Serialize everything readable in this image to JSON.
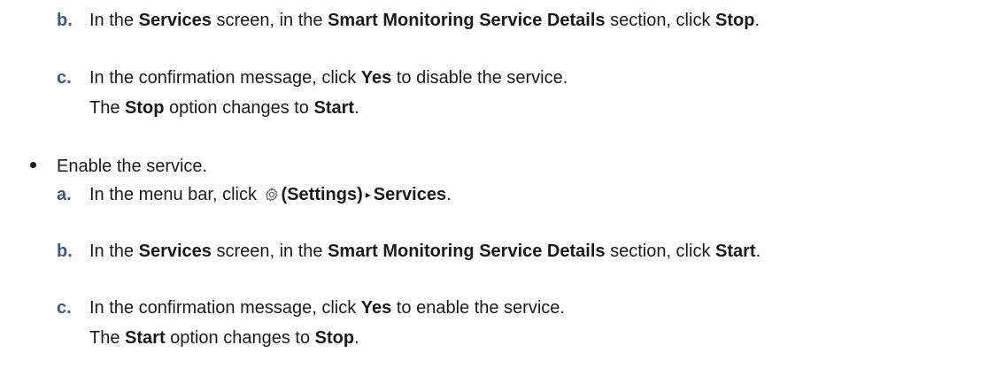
{
  "steps_disable": {
    "b": {
      "marker": "b.",
      "t1": "In the ",
      "b1": "Services",
      "t2": " screen, in the ",
      "b2": "Smart Monitoring Service Details",
      "t3": " section, click ",
      "b3": "Stop",
      "t4": "."
    },
    "c": {
      "marker": "c.",
      "t1": "In the confirmation message, click ",
      "b1": "Yes",
      "t2": " to disable the service.",
      "result": {
        "t1": "The ",
        "b1": "Stop",
        "t2": " option changes to ",
        "b2": "Start",
        "t3": "."
      }
    }
  },
  "enable": {
    "heading": "Enable the service.",
    "a": {
      "marker": "a.",
      "t1": "In the menu bar, click ",
      "icon": "gear-icon",
      "b1": "(Settings)",
      "arrow": "▸",
      "b2": "Services",
      "t2": "."
    },
    "b": {
      "marker": "b.",
      "t1": "In the ",
      "b1": "Services",
      "t2": " screen, in the ",
      "b2": "Smart Monitoring Service Details",
      "t3": " section, click ",
      "b3": "Start",
      "t4": "."
    },
    "c": {
      "marker": "c.",
      "t1": "In the confirmation message, click ",
      "b1": "Yes",
      "t2": " to enable the service.",
      "result": {
        "t1": "The ",
        "b1": "Start",
        "t2": " option changes to ",
        "b2": "Stop",
        "t3": "."
      }
    }
  },
  "colors": {
    "marker": "#3a5a8c",
    "text": "#1a1a1a"
  }
}
